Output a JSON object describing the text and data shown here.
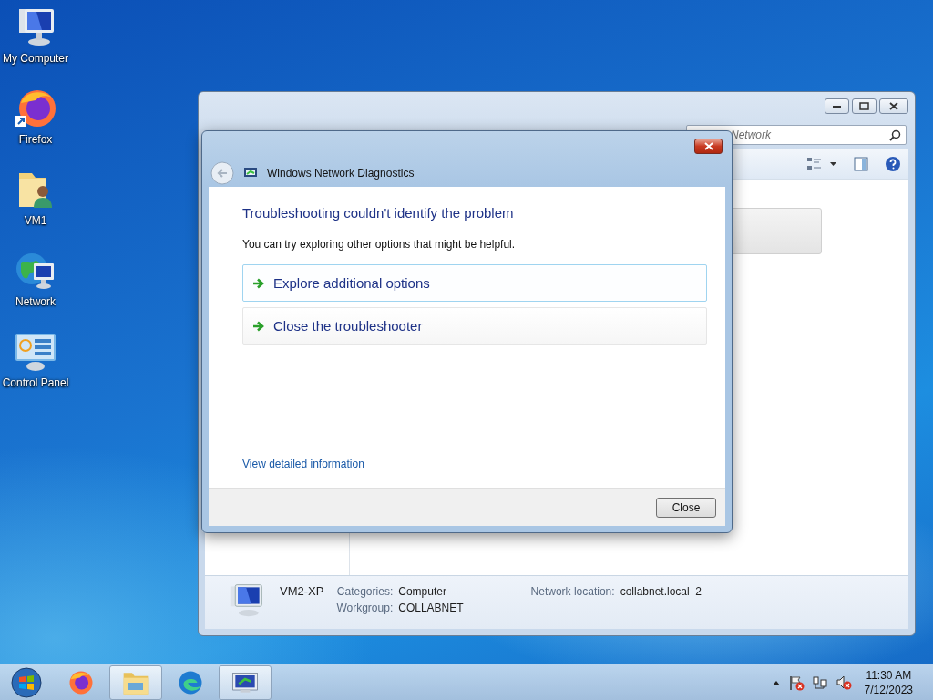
{
  "desktop_icons": [
    {
      "label": "My Computer",
      "kind": "computer"
    },
    {
      "label": "Firefox",
      "kind": "firefox"
    },
    {
      "label": "VM1",
      "kind": "user-folder"
    },
    {
      "label": "Network",
      "kind": "network"
    },
    {
      "label": "Control Panel",
      "kind": "control-panel"
    }
  ],
  "explorer": {
    "search": {
      "placeholder": "Network"
    },
    "details": {
      "name": "VM2-XP",
      "fields": [
        {
          "label": "Categories:",
          "value": "Computer"
        },
        {
          "label": "Workgroup:",
          "value": "COLLABNET"
        },
        {
          "label": "Network location:",
          "value": "collabnet.local  2"
        }
      ]
    }
  },
  "dialog": {
    "title": "Windows Network Diagnostics",
    "heading": "Troubleshooting couldn't identify the problem",
    "message": "You can try exploring other options that might be helpful.",
    "options": [
      {
        "label": "Explore additional options",
        "selected": true
      },
      {
        "label": "Close the troubleshooter",
        "selected": false
      }
    ],
    "link": "View detailed information",
    "buttons": [
      "Close"
    ]
  },
  "taskbar": {
    "items": [
      {
        "kind": "start",
        "active": false
      },
      {
        "kind": "firefox",
        "active": false
      },
      {
        "kind": "explorer",
        "active": true
      },
      {
        "kind": "edge",
        "active": false
      },
      {
        "kind": "diagnostics",
        "active": true
      }
    ],
    "tray": [
      {
        "kind": "arrow"
      },
      {
        "kind": "flag"
      },
      {
        "kind": "network"
      },
      {
        "kind": "speaker"
      }
    ],
    "clock": {
      "time": "11:30 AM",
      "date": "7/12/2023"
    }
  }
}
